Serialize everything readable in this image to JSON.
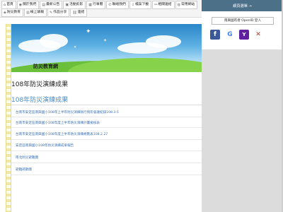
{
  "nav": {
    "row1": [
      {
        "label": "首頁",
        "icon": "home-icon"
      },
      {
        "label": "關於我們",
        "icon": "info-icon"
      },
      {
        "label": "最新公告",
        "icon": "news-icon"
      },
      {
        "label": "活動剪影",
        "icon": "photo-icon"
      },
      {
        "label": "行事曆",
        "icon": "calendar-icon"
      },
      {
        "label": "聯絡我們",
        "icon": "phone-icon"
      },
      {
        "label": "檔案下載",
        "icon": "download-icon"
      },
      {
        "label": "相關連結",
        "icon": "link-icon"
      },
      {
        "label": "常用網站",
        "icon": "globe-icon"
      }
    ],
    "row2": [
      {
        "label": "防災教育",
        "icon": "shield-icon"
      },
      {
        "label": "線上填報",
        "icon": "form-icon"
      },
      {
        "label": "作品分享",
        "icon": "share-icon"
      },
      {
        "label": "連結",
        "icon": "chain-icon"
      }
    ]
  },
  "banner": {
    "title": "防災教育網"
  },
  "page": {
    "title": "108年防災演練成果",
    "subtitle": "108年防災演練成果",
    "links": [
      "台南市安定區南興國小108年上半年防災演練執行情形會議紀錄108.3.5",
      "台南市安定區南興國小108年度上半年防災演練計畫檢核表",
      "台南市安定區南興國小108年度上半年防災演練規劃表108.2.27",
      "安定區南興國小108年防災演練成果報告",
      "南北防災避難圖",
      "避難疏散圖"
    ]
  },
  "sidebar": {
    "login_title": "網頁選單 →",
    "openid_label": "南興國有者 OpenID 登入"
  }
}
